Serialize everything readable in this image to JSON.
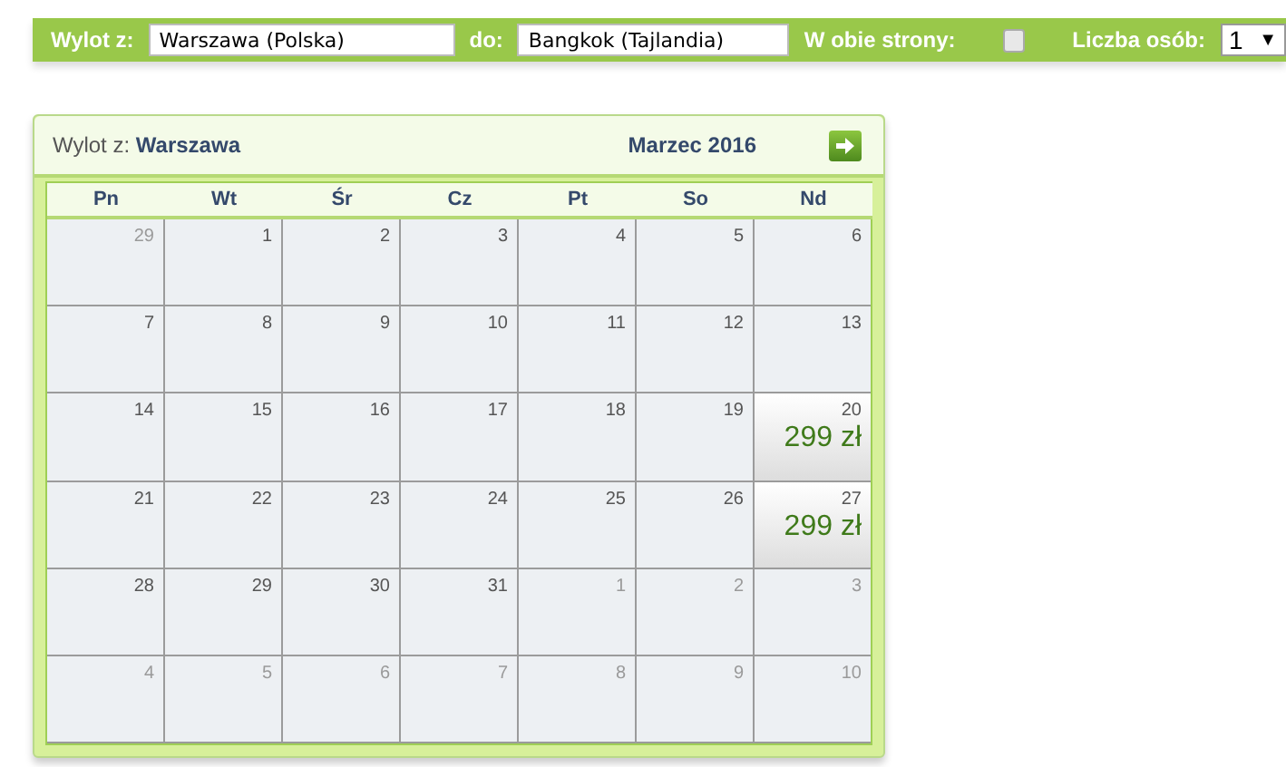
{
  "search_bar": {
    "from_label": "Wylot z:",
    "from_value": "Warszawa (Polska)",
    "to_label": "do:",
    "to_value": "Bangkok (Tajlandia)",
    "round_trip_label": "W obie strony:",
    "round_trip_checked": false,
    "passengers_label": "Liczba osób:",
    "passengers_value": "1",
    "dropdown_arrow": "▼"
  },
  "calendar": {
    "origin_label": "Wylot z:",
    "origin": "Warszawa",
    "month": "Marzec 2016",
    "weekdays": [
      "Pn",
      "Wt",
      "Śr",
      "Cz",
      "Pt",
      "So",
      "Nd"
    ],
    "weeks": [
      [
        {
          "day": "29",
          "muted": true
        },
        {
          "day": "1",
          "muted": false
        },
        {
          "day": "2",
          "muted": false
        },
        {
          "day": "3",
          "muted": false
        },
        {
          "day": "4",
          "muted": false
        },
        {
          "day": "5",
          "muted": false
        },
        {
          "day": "6",
          "muted": false
        }
      ],
      [
        {
          "day": "7",
          "muted": false
        },
        {
          "day": "8",
          "muted": false
        },
        {
          "day": "9",
          "muted": false
        },
        {
          "day": "10",
          "muted": false
        },
        {
          "day": "11",
          "muted": false
        },
        {
          "day": "12",
          "muted": false
        },
        {
          "day": "13",
          "muted": false
        }
      ],
      [
        {
          "day": "14",
          "muted": false
        },
        {
          "day": "15",
          "muted": false
        },
        {
          "day": "16",
          "muted": false
        },
        {
          "day": "17",
          "muted": false
        },
        {
          "day": "18",
          "muted": false
        },
        {
          "day": "19",
          "muted": false
        },
        {
          "day": "20",
          "muted": false,
          "price": "299 zł"
        }
      ],
      [
        {
          "day": "21",
          "muted": false
        },
        {
          "day": "22",
          "muted": false
        },
        {
          "day": "23",
          "muted": false
        },
        {
          "day": "24",
          "muted": false
        },
        {
          "day": "25",
          "muted": false
        },
        {
          "day": "26",
          "muted": false
        },
        {
          "day": "27",
          "muted": false,
          "price": "299 zł"
        }
      ],
      [
        {
          "day": "28",
          "muted": false
        },
        {
          "day": "29",
          "muted": false
        },
        {
          "day": "30",
          "muted": false
        },
        {
          "day": "31",
          "muted": false
        },
        {
          "day": "1",
          "muted": true
        },
        {
          "day": "2",
          "muted": true
        },
        {
          "day": "3",
          "muted": true
        }
      ],
      [
        {
          "day": "4",
          "muted": true
        },
        {
          "day": "5",
          "muted": true
        },
        {
          "day": "6",
          "muted": true
        },
        {
          "day": "7",
          "muted": true
        },
        {
          "day": "8",
          "muted": true
        },
        {
          "day": "9",
          "muted": true
        },
        {
          "day": "10",
          "muted": true
        }
      ]
    ]
  }
}
